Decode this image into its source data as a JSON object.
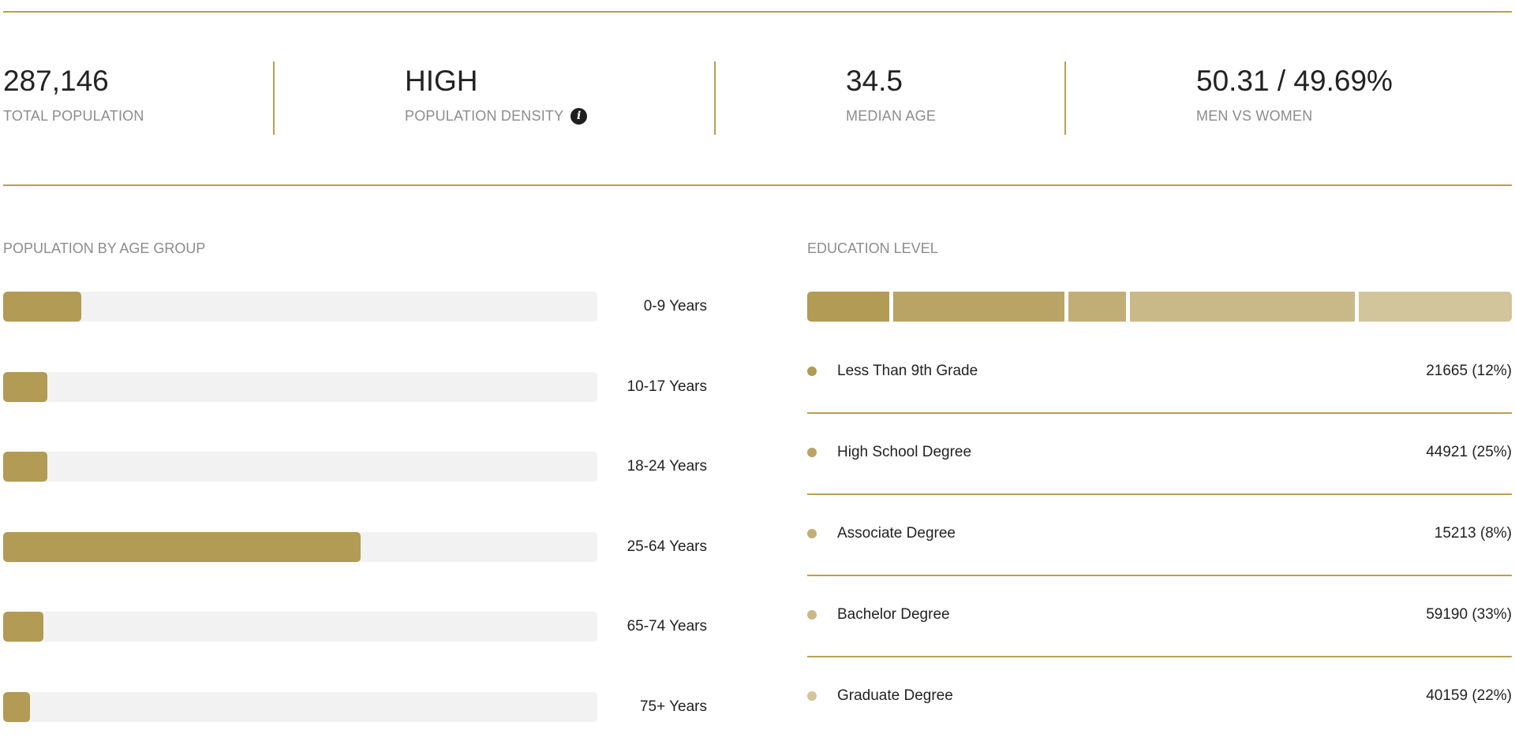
{
  "stats": [
    {
      "value": "287,146",
      "label": "TOTAL POPULATION"
    },
    {
      "value": "HIGH",
      "label": "POPULATION DENSITY",
      "icon": "info-icon"
    },
    {
      "value": "34.5",
      "label": "MEDIAN AGE"
    },
    {
      "value": "50.31 / 49.69%",
      "label": "MEN VS WOMEN"
    }
  ],
  "age_section": {
    "title": "POPULATION BY AGE GROUP",
    "groups": [
      {
        "label": "0-9 Years",
        "fraction": 0.132
      },
      {
        "label": "10-17 Years",
        "fraction": 0.075
      },
      {
        "label": "18-24 Years",
        "fraction": 0.074
      },
      {
        "label": "25-64 Years",
        "fraction": 0.602
      },
      {
        "label": "65-74 Years",
        "fraction": 0.068
      },
      {
        "label": "75+ Years",
        "fraction": 0.045
      }
    ]
  },
  "education_section": {
    "title": "EDUCATION LEVEL",
    "levels": [
      {
        "name": "Less Than 9th Grade",
        "value": "21665 (12%)",
        "count": 21665,
        "color": "#b19b55"
      },
      {
        "name": "High School Degree",
        "value": "44921 (25%)",
        "count": 44921,
        "color": "#b9a466"
      },
      {
        "name": "Associate Degree",
        "value": "15213 (8%)",
        "count": 15213,
        "color": "#c1ae77"
      },
      {
        "name": "Bachelor Degree",
        "value": "59190 (33%)",
        "count": 59190,
        "color": "#c9b988"
      },
      {
        "name": "Graduate Degree",
        "value": "40159 (22%)",
        "count": 40159,
        "color": "#d2c49b"
      }
    ]
  },
  "colors": {
    "accent": "#b8a04f",
    "bar_fill": "#b19b55",
    "track": "#f2f2f2",
    "muted_text": "#8c8c8c"
  }
}
